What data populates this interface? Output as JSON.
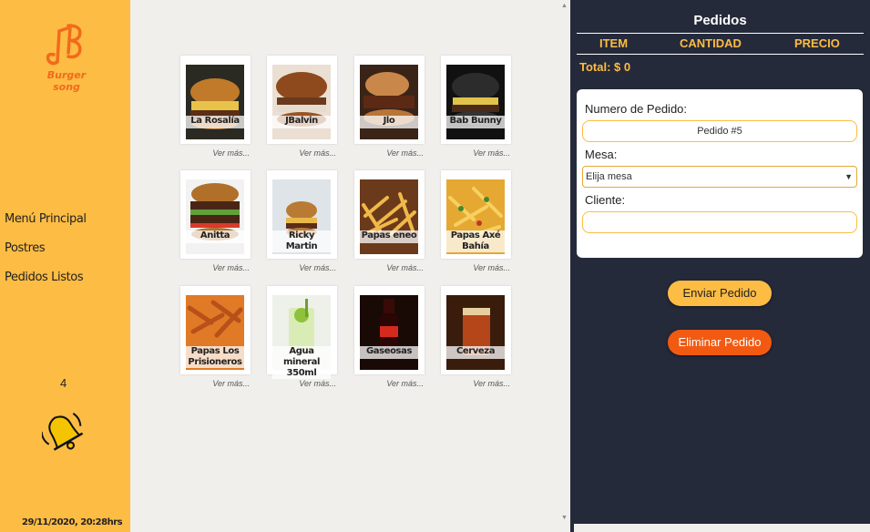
{
  "brand": {
    "name": "Burger song"
  },
  "nav": {
    "items": [
      "Menú Principal",
      "Postres",
      "Pedidos Listos"
    ]
  },
  "notifications": {
    "count": "4"
  },
  "datetime": "29/11/2020, 20:28hrs",
  "products": [
    {
      "name": "La Rosalía",
      "more": "Ver más..."
    },
    {
      "name": "JBalvin",
      "more": "Ver más..."
    },
    {
      "name": "Jlo",
      "more": "Ver más..."
    },
    {
      "name": "Bab Bunny",
      "more": "Ver más..."
    },
    {
      "name": "Anitta",
      "more": "Ver más..."
    },
    {
      "name": "Ricky Martin",
      "more": "Ver más..."
    },
    {
      "name": "Papas eneo",
      "more": "Ver más..."
    },
    {
      "name": "Papas Axé Bahía",
      "more": "Ver más..."
    },
    {
      "name": "Papas Los Prisioneros",
      "more": "Ver más..."
    },
    {
      "name": "Agua mineral 350ml",
      "more": "Ver más..."
    },
    {
      "name": "Gaseosas",
      "more": "Ver más..."
    },
    {
      "name": "Cerveza",
      "more": "Ver más..."
    }
  ],
  "order": {
    "title": "Pedidos",
    "columns": [
      "ITEM",
      "CANTIDAD",
      "PRECIO"
    ],
    "total": "Total: $ 0",
    "form": {
      "number_label": "Numero de Pedido:",
      "number_value": "Pedido #5",
      "table_label": "Mesa:",
      "table_value": "Elija mesa",
      "client_label": "Cliente:",
      "client_value": ""
    },
    "send_label": "Enviar Pedido",
    "delete_label": "Eliminar Pedido"
  },
  "colors": {
    "accent": "#fdbc44",
    "panel": "#252a3b",
    "danger": "#f25a12",
    "brand_text": "#f26a1b"
  }
}
